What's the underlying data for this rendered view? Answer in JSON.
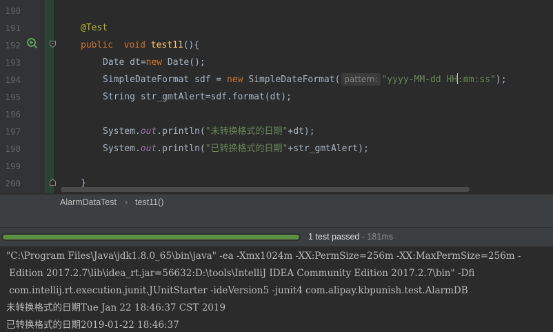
{
  "editor": {
    "line_numbers": [
      "190",
      "191",
      "192",
      "193",
      "194",
      "195",
      "196",
      "197",
      "198",
      "199",
      "200"
    ],
    "annotation": "@Test",
    "kw_public": "public",
    "kw_void": "void",
    "method_name": "test11",
    "method_tail": "(){",
    "l193_type": "Date dt=",
    "kw_new": "new",
    "l193_ctor": " Date();",
    "l194_decl": "SimpleDateFormat sdf = ",
    "l194_ctor": " SimpleDateFormat(",
    "param_hint": "pattern:",
    "l194_str_a": "\"yyyy-MM-dd HH",
    "l194_str_b": ":mm:ss\"",
    "l194_end": ");",
    "l195": "String str_gmtAlert=sdf.format(dt);",
    "sys": "System.",
    "out": "out",
    "println": ".println(",
    "str1": "\"未转换格式的日期\"",
    "l197_tail": "+dt);",
    "str2": "\"已转换格式的日期\"",
    "l198_tail": "+str_gmtAlert);",
    "close_brace": "}"
  },
  "breadcrumb": {
    "class_name": "AlarmDataTest",
    "separator": "›",
    "method": "test11()"
  },
  "test_status": {
    "passed_text": "1 test passed",
    "duration": " - 181ms",
    "progress": 1.0,
    "progress_color": "#5b8d43"
  },
  "console": {
    "lines": [
      "\"C:\\Program Files\\Java\\jdk1.8.0_65\\bin\\java\" -ea -Xmx1024m -XX:PermSize=256m -XX:MaxPermSize=256m -",
      " Edition 2017.2.7\\lib\\idea_rt.jar=56632:D:\\tools\\IntelliJ IDEA Community Edition 2017.2.7\\bin\" -Dfi",
      " com.intellij.rt.execution.junit.JUnitStarter -ideVersion5 -junit4 com.alipay.kbpunish.test.AlarmDB",
      "未转换格式的日期Tue Jan 22 18:46:37 CST 2019",
      "已转换格式的日期2019-01-22 18:46:37"
    ]
  },
  "icons": {
    "run": "run-test-icon",
    "fold": "fold-marker-icon"
  }
}
